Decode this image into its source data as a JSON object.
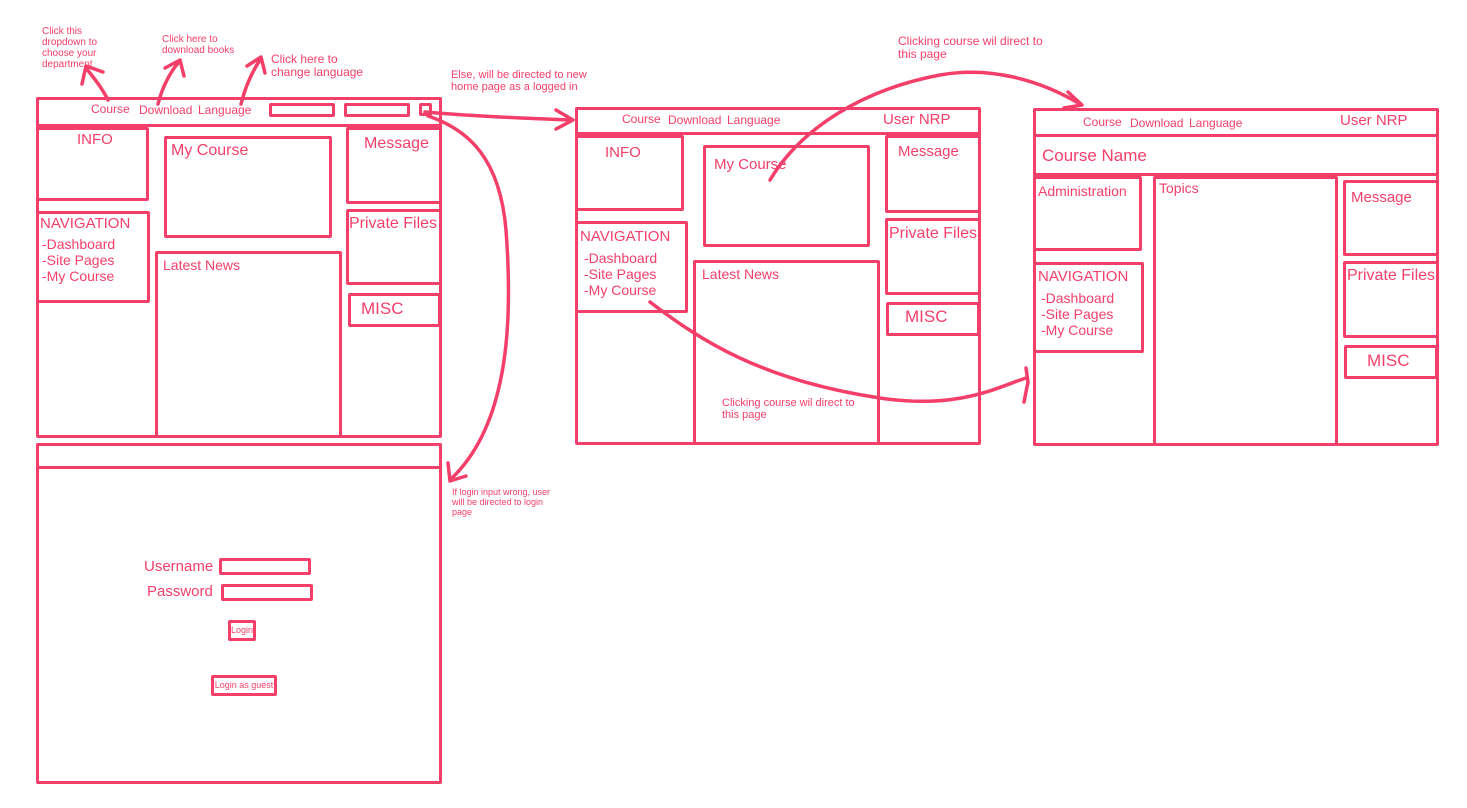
{
  "notes": {
    "dropdown": "Click this dropdown to choose your department",
    "download": "Click  here to download books",
    "language": "Click here to change language",
    "else_logged_in": "Else, will be directed to new home page as a logged in",
    "course_direct_top": "Clicking course wil direct to this page",
    "course_direct_bottom": "Clicking course wil direct to this page",
    "login_wrong": "If login input wrong, user will be directed to login page"
  },
  "guest_home": {
    "menu_course": "Course",
    "menu_download": "Download",
    "menu_language": "Language",
    "info": "INFO",
    "my_course": "My Course",
    "message": "Message",
    "navigation": "NAVIGATION",
    "nav_items": [
      "-Dashboard",
      "-Site Pages",
      "-My Course"
    ],
    "private_files": "Private Files",
    "latest_news": "Latest News",
    "misc": "MISC"
  },
  "logged_home": {
    "menu_course": "Course",
    "menu_download": "Download",
    "menu_language": "Language",
    "user": "User NRP",
    "info": "INFO",
    "my_course": "My Course",
    "message": "Message",
    "navigation": "NAVIGATION",
    "nav_items": [
      "-Dashboard",
      "-Site Pages",
      "-My Course"
    ],
    "private_files": "Private Files",
    "latest_news": "Latest News",
    "misc": "MISC"
  },
  "course_page": {
    "menu_course": "Course",
    "menu_download": "Download",
    "menu_language": "Language",
    "user": "User NRP",
    "course_name": "Course Name",
    "administration": "Administration",
    "topics": "Topics",
    "message": "Message",
    "navigation": "NAVIGATION",
    "nav_items": [
      "-Dashboard",
      "-Site Pages",
      "-My Course"
    ],
    "private_files": "Private Files",
    "misc": "MISC"
  },
  "login_page": {
    "username_label": "Username",
    "password_label": "Password",
    "login_button": "Login",
    "guest_button": "Login as guest"
  },
  "colors": {
    "ink": "#f43f6a",
    "background": "#ffffff"
  }
}
